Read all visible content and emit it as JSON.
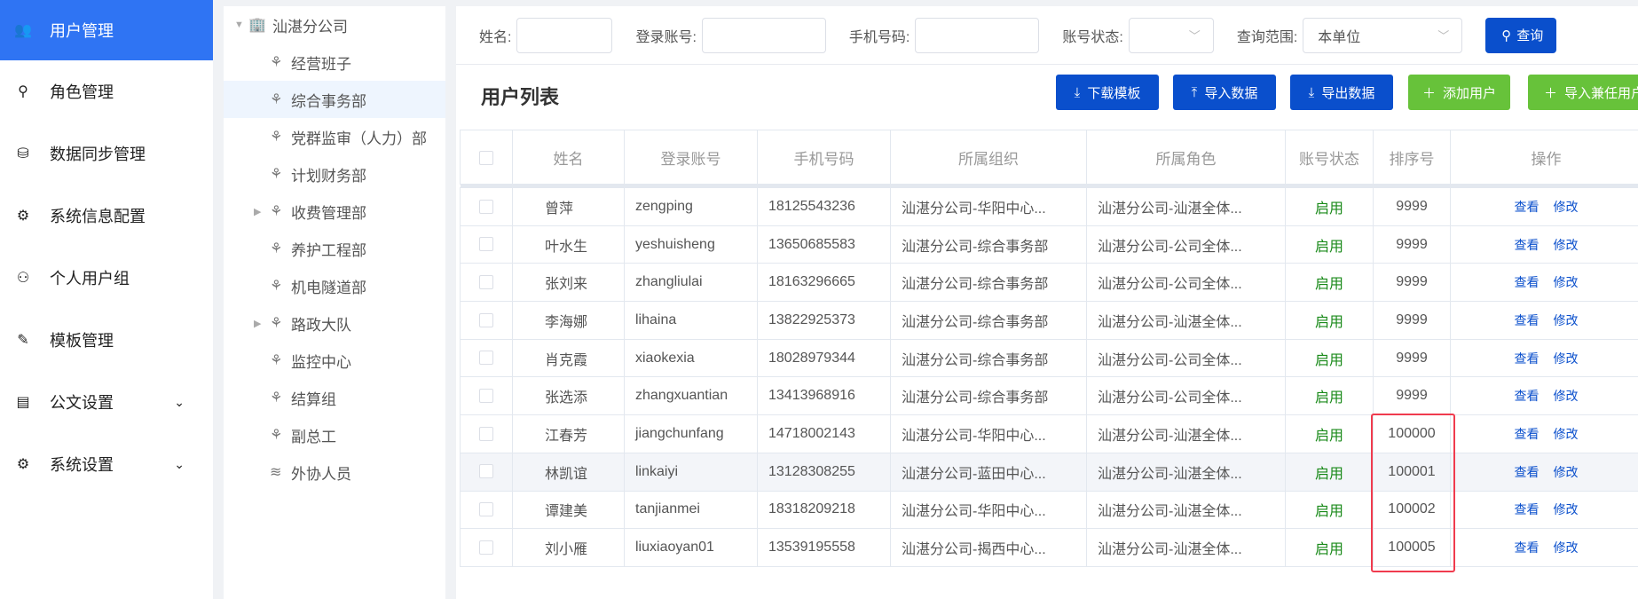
{
  "sidebar": {
    "items": [
      {
        "label": "用户管理",
        "icon": "user-group-icon",
        "active": true
      },
      {
        "label": "角色管理",
        "icon": "role-icon"
      },
      {
        "label": "数据同步管理",
        "icon": "database-sync-icon"
      },
      {
        "label": "系统信息配置",
        "icon": "gears-icon"
      },
      {
        "label": "个人用户组",
        "icon": "person-group-icon"
      },
      {
        "label": "模板管理",
        "icon": "template-icon"
      },
      {
        "label": "公文设置",
        "icon": "document-icon",
        "expandable": true
      },
      {
        "label": "系统设置",
        "icon": "settings-icon",
        "expandable": true
      }
    ]
  },
  "tree": {
    "root": "汕湛分公司",
    "nodes": [
      {
        "label": "经营班子"
      },
      {
        "label": "综合事务部",
        "selected": true
      },
      {
        "label": "党群监审（人力）部"
      },
      {
        "label": "计划财务部"
      },
      {
        "label": "收费管理部",
        "expandable": true
      },
      {
        "label": "养护工程部"
      },
      {
        "label": "机电隧道部"
      },
      {
        "label": "路政大队",
        "expandable": true
      },
      {
        "label": "监控中心"
      },
      {
        "label": "结算组"
      },
      {
        "label": "副总工"
      },
      {
        "label": "外协人员"
      }
    ]
  },
  "filters": {
    "name_label": "姓名:",
    "name_value": "",
    "account_label": "登录账号:",
    "account_value": "",
    "phone_label": "手机号码:",
    "phone_value": "",
    "status_label": "账号状态:",
    "status_value": "",
    "scope_label": "查询范围:",
    "scope_value": "本单位",
    "search_label": "查询"
  },
  "toolbar": {
    "title": "用户列表",
    "download_template": "下载模板",
    "import_data": "导入数据",
    "export_data": "导出数据",
    "add_user": "添加用户",
    "import_concurrent": "导入兼任用户"
  },
  "table": {
    "columns": [
      "姓名",
      "登录账号",
      "手机号码",
      "所属组织",
      "所属角色",
      "账号状态",
      "排序号",
      "操作"
    ],
    "actions": {
      "view": "查看",
      "edit": "修改"
    },
    "rows": [
      [
        "曾萍",
        "zengping",
        "18125543236",
        "汕湛分公司-华阳中心...",
        "汕湛分公司-汕湛全体...",
        "启用",
        "9999"
      ],
      [
        "叶水生",
        "yeshuisheng",
        "13650685583",
        "汕湛分公司-综合事务部",
        "汕湛分公司-公司全体...",
        "启用",
        "9999"
      ],
      [
        "张刘来",
        "zhangliulai",
        "18163296665",
        "汕湛分公司-综合事务部",
        "汕湛分公司-公司全体...",
        "启用",
        "9999"
      ],
      [
        "李海娜",
        "lihaina",
        "13822925373",
        "汕湛分公司-综合事务部",
        "汕湛分公司-汕湛全体...",
        "启用",
        "9999"
      ],
      [
        "肖克霞",
        "xiaokexia",
        "18028979344",
        "汕湛分公司-综合事务部",
        "汕湛分公司-公司全体...",
        "启用",
        "9999"
      ],
      [
        "张选添",
        "zhangxuantian",
        "13413968916",
        "汕湛分公司-综合事务部",
        "汕湛分公司-公司全体...",
        "启用",
        "9999"
      ],
      [
        "江春芳",
        "jiangchunfang",
        "14718002143",
        "汕湛分公司-华阳中心...",
        "汕湛分公司-汕湛全体...",
        "启用",
        "100000"
      ],
      [
        "林凯谊",
        "linkaiyi",
        "13128308255",
        "汕湛分公司-蓝田中心...",
        "汕湛分公司-汕湛全体...",
        "启用",
        "100001"
      ],
      [
        "谭建美",
        "tanjianmei",
        "18318209218",
        "汕湛分公司-华阳中心...",
        "汕湛分公司-汕湛全体...",
        "启用",
        "100002"
      ],
      [
        "刘小雁",
        "liuxiaoyan01",
        "13539195558",
        "汕湛分公司-揭西中心...",
        "汕湛分公司-汕湛全体...",
        "启用",
        "100005"
      ]
    ],
    "highlighted_row": 7
  },
  "colors": {
    "accent": "#2f74f3",
    "primary_button": "#0a4fcc",
    "success_button": "#67c23a",
    "enabled_text": "#1a8a1a",
    "annotation_box": "#f03b4e"
  }
}
